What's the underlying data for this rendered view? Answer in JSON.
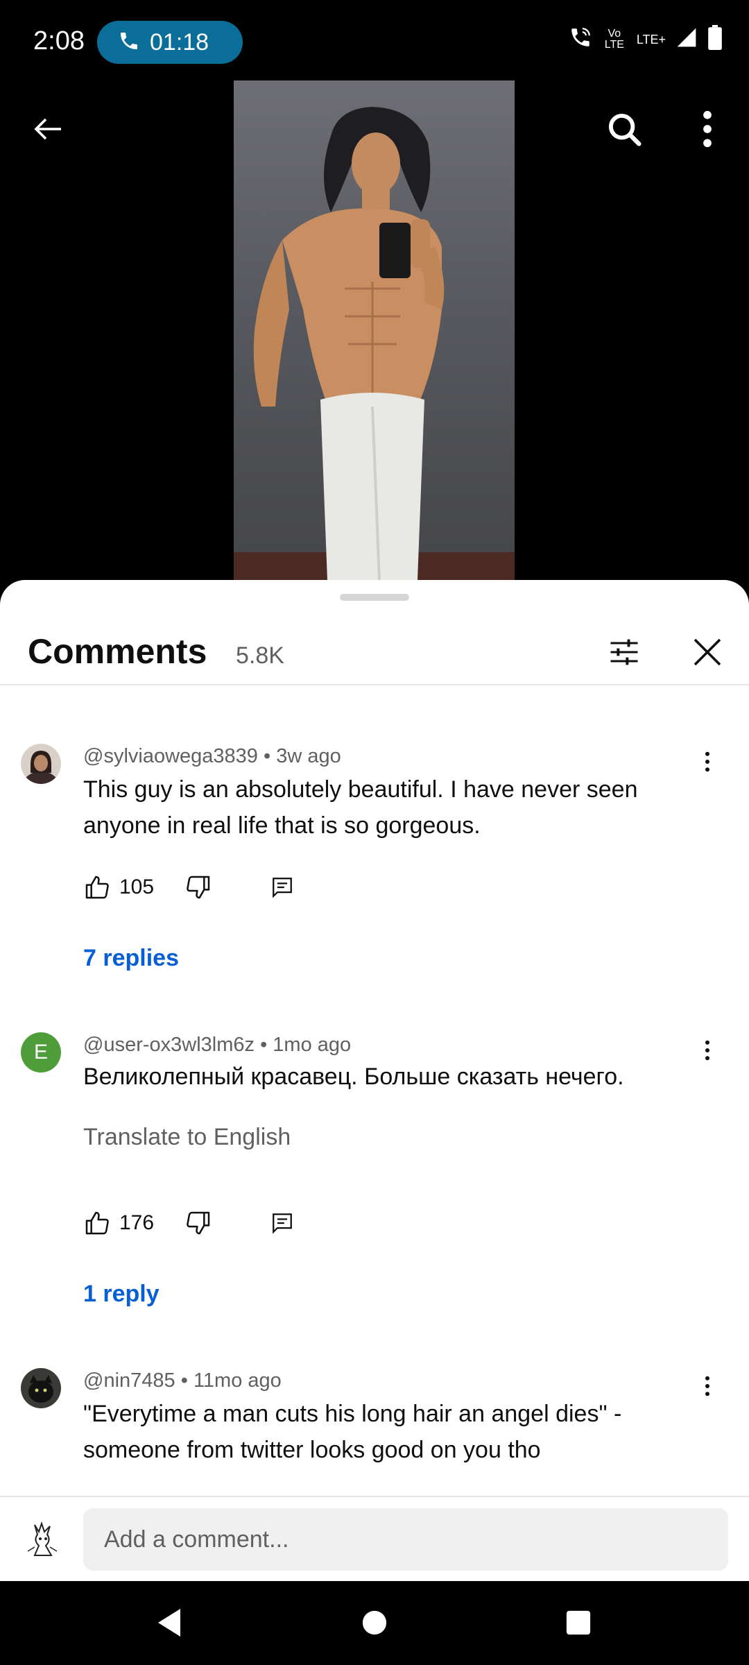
{
  "status_bar": {
    "time": "2:08",
    "call_duration": "01:18",
    "volte_label": "Vo LTE",
    "lte_label": "LTE+"
  },
  "sheet": {
    "title": "Comments",
    "count": "5.8K"
  },
  "comments": [
    {
      "handle": "@sylviaowega3839",
      "age": "3w ago",
      "text": "This guy is an absolutely beautiful. I have never seen anyone in real life that is so gorgeous.",
      "likes": "105",
      "replies_label": "7 replies",
      "avatar_letter": ""
    },
    {
      "handle": "@user-ox3wl3lm6z",
      "age": "1mo ago",
      "text": "Великолепный красавец. Больше сказать нечего.",
      "translate_label": "Translate to English",
      "likes": "176",
      "replies_label": "1 reply",
      "avatar_letter": "E"
    },
    {
      "handle": "@nin7485",
      "age": "11mo ago",
      "text": "\"Everytime a man cuts his long hair an angel dies\" -someone from twitter looks good on you tho",
      "avatar_letter": ""
    }
  ],
  "add_comment": {
    "placeholder": "Add a comment..."
  },
  "colors": {
    "call_pill": "#0b6e99",
    "link": "#065fd4",
    "avatar_e": "#4f9d3a"
  }
}
